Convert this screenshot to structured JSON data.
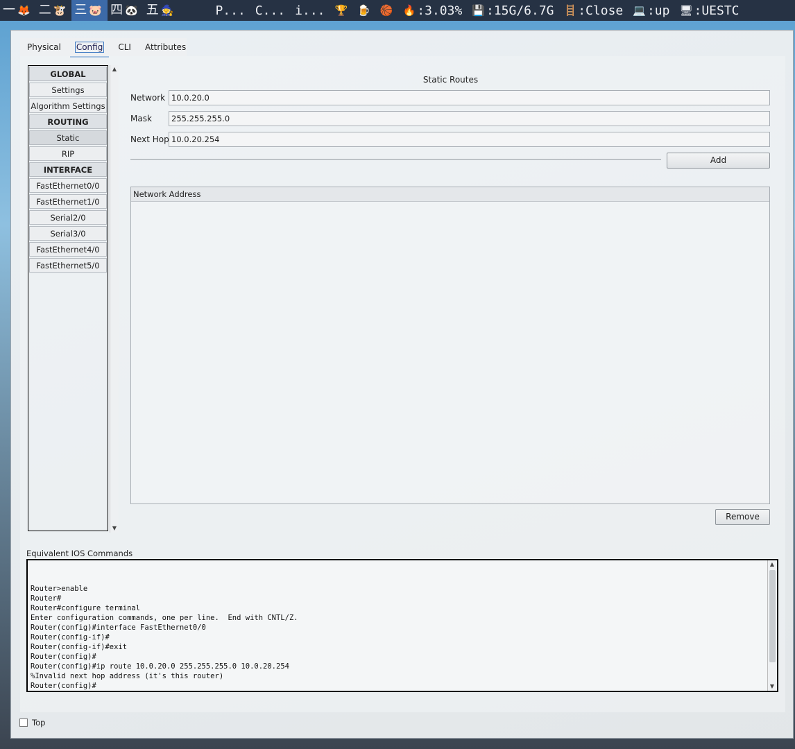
{
  "topbar": {
    "workspaces": [
      {
        "label": "一",
        "emoji": "🦊",
        "icon": "fox-icon"
      },
      {
        "label": "二",
        "emoji": "🐮",
        "icon": "cow-icon"
      },
      {
        "label": "三",
        "emoji": "🐷",
        "icon": "pig-icon"
      },
      {
        "label": "四",
        "emoji": "🐼",
        "icon": "panda-icon"
      },
      {
        "label": "五",
        "emoji": "🧙",
        "icon": "mage-icon"
      }
    ],
    "windows": [
      "P...",
      "C...",
      "i..."
    ],
    "status": {
      "trophy_icon": "🏆",
      "beer_icon": "🍺",
      "ball_icon": "🏀",
      "cpu_icon": "🔥",
      "cpu": ":3.03%",
      "mem_icon": "💾",
      "mem": ":15G/6.7G",
      "ladder_icon": "🪜",
      "ladder": ":Close",
      "net_icon": "💻",
      "net": ":up",
      "host_icon": "🖥",
      "host": ":UESTC"
    }
  },
  "tabs": [
    "Physical",
    "Config",
    "CLI",
    "Attributes"
  ],
  "nav": [
    {
      "label": "GLOBAL",
      "header": true
    },
    {
      "label": "Settings"
    },
    {
      "label": "Algorithm Settings"
    },
    {
      "label": "ROUTING",
      "header": true
    },
    {
      "label": "Static",
      "selected": true
    },
    {
      "label": "RIP"
    },
    {
      "label": "INTERFACE",
      "header": true
    },
    {
      "label": "FastEthernet0/0"
    },
    {
      "label": "FastEthernet1/0"
    },
    {
      "label": "Serial2/0"
    },
    {
      "label": "Serial3/0"
    },
    {
      "label": "FastEthernet4/0"
    },
    {
      "label": "FastEthernet5/0"
    }
  ],
  "static_routes": {
    "title": "Static Routes",
    "network_label": "Network",
    "network_value": "10.0.20.0",
    "mask_label": "Mask",
    "mask_value": "255.255.255.0",
    "next_hop_label": "Next Hop",
    "next_hop_value": "10.0.20.254",
    "add_label": "Add",
    "list_header": "Network Address",
    "remove_label": "Remove"
  },
  "ios": {
    "label": "Equivalent IOS Commands",
    "text": "Router>enable\nRouter#\nRouter#configure terminal\nEnter configuration commands, one per line.  End with CNTL/Z.\nRouter(config)#interface FastEthernet0/0\nRouter(config-if)#\nRouter(config-if)#exit\nRouter(config)#\nRouter(config)#ip route 10.0.20.0 255.255.255.0 10.0.20.254\n%Invalid next hop address (it's this router)\nRouter(config)#"
  },
  "top_checkbox_label": "Top"
}
